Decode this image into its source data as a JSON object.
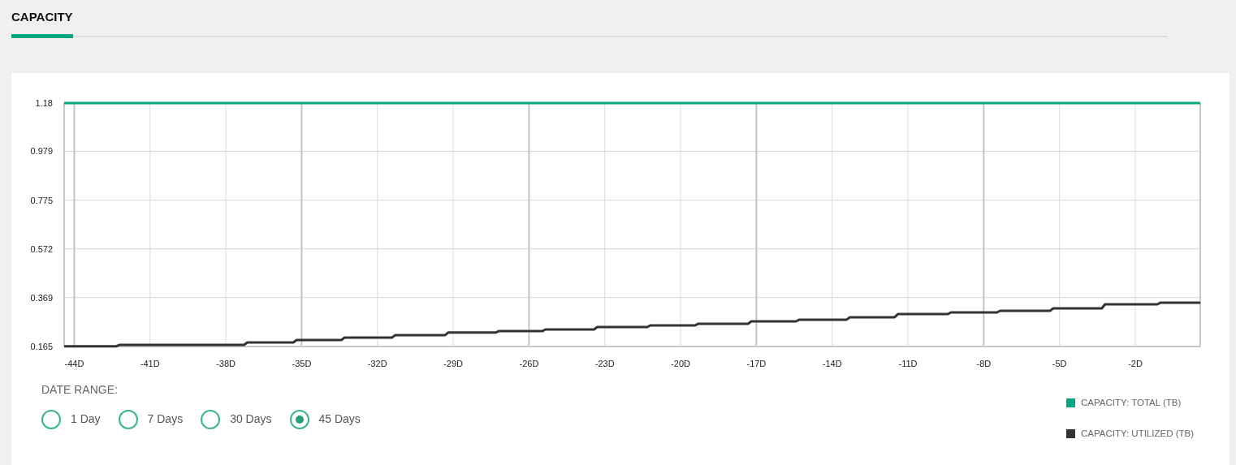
{
  "header": {
    "tabs": [
      {
        "label": "CAPACITY",
        "selected": true
      }
    ]
  },
  "chart": {
    "chart_data": {
      "type": "line",
      "x": [
        -44.4,
        -42.2,
        -37.15,
        -35.2,
        -33.3,
        -31.3,
        -29.2,
        -27.2,
        -25.35,
        -23.3,
        -21.2,
        -19.3,
        -17.2,
        -15.3,
        -13.3,
        -11.4,
        -9.3,
        -7.35,
        -5.25,
        -3.2,
        -1.0,
        0.57
      ],
      "series": [
        {
          "name": "CAPACITY: TOTAL (TB)",
          "color": "#01a982",
          "values": [
            1.18,
            1.18,
            1.18,
            1.18,
            1.18,
            1.18,
            1.18,
            1.18,
            1.18,
            1.18,
            1.18,
            1.18,
            1.18,
            1.18,
            1.18,
            1.18,
            1.18,
            1.18,
            1.18,
            1.18,
            1.18,
            1.18
          ]
        },
        {
          "name": "CAPACITY: UTILIZED (TB)",
          "color": "#333333",
          "values": [
            0.166,
            0.172,
            0.182,
            0.192,
            0.202,
            0.212,
            0.223,
            0.229,
            0.236,
            0.246,
            0.253,
            0.26,
            0.27,
            0.277,
            0.287,
            0.3,
            0.307,
            0.314,
            0.324,
            0.341,
            0.348,
            0.348
          ]
        }
      ],
      "grid": true,
      "xlim": [
        -44.4,
        0.57
      ],
      "ylim": [
        0.165,
        1.18
      ],
      "xticks": [
        {
          "value": -44,
          "label": "-44D"
        },
        {
          "value": -41,
          "label": "-41D"
        },
        {
          "value": -38,
          "label": "-38D"
        },
        {
          "value": -35,
          "label": "-35D"
        },
        {
          "value": -32,
          "label": "-32D"
        },
        {
          "value": -29,
          "label": "-29D"
        },
        {
          "value": -26,
          "label": "-26D"
        },
        {
          "value": -23,
          "label": "-23D"
        },
        {
          "value": -20,
          "label": "-20D"
        },
        {
          "value": -17,
          "label": "-17D"
        },
        {
          "value": -14,
          "label": "-14D"
        },
        {
          "value": -11,
          "label": "-11D"
        },
        {
          "value": -8,
          "label": "-8D"
        },
        {
          "value": -5,
          "label": "-5D"
        },
        {
          "value": -2,
          "label": "-2D"
        }
      ],
      "yticks": [
        {
          "value": 0.165,
          "label": "0.165"
        },
        {
          "value": 0.369,
          "label": "0.369"
        },
        {
          "value": 0.572,
          "label": "0.572"
        },
        {
          "value": 0.775,
          "label": "0.775"
        },
        {
          "value": 0.979,
          "label": "0.979"
        },
        {
          "value": 1.18,
          "label": "1.18"
        }
      ]
    }
  },
  "date_range": {
    "label": "DATE RANGE:",
    "options": [
      {
        "label": "1 Day",
        "selected": false
      },
      {
        "label": "7 Days",
        "selected": false
      },
      {
        "label": "30 Days",
        "selected": false
      },
      {
        "label": "45 Days",
        "selected": true
      }
    ]
  }
}
